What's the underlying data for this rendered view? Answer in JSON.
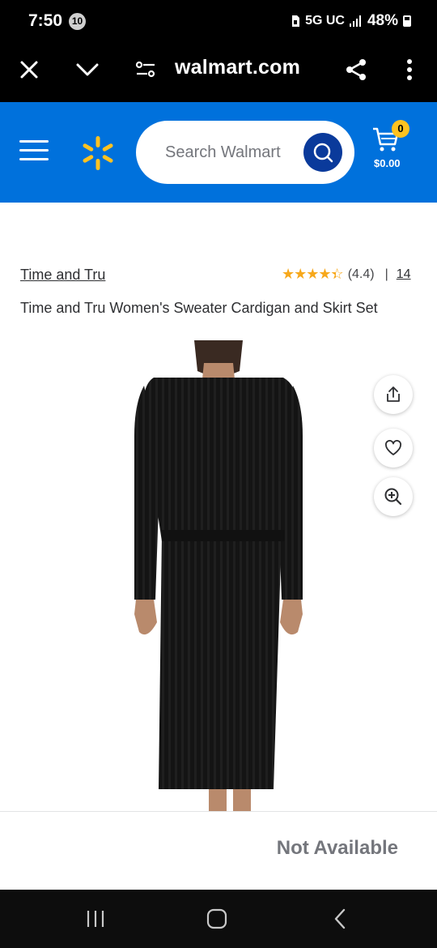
{
  "status_bar": {
    "time": "7:50",
    "notification_count": "10",
    "network": "5G UC",
    "battery": "48%"
  },
  "browser": {
    "url": "walmart.com",
    "icons": [
      "close-icon",
      "chevron-down-icon",
      "site-settings-icon",
      "share-icon",
      "more-vert-icon"
    ]
  },
  "header": {
    "search_placeholder": "Search Walmart",
    "cart_count": "0",
    "cart_total": "$0.00",
    "colors": {
      "brand_blue": "#0071dc",
      "spark_yellow": "#ffc220",
      "search_button": "#0a3a9b"
    }
  },
  "product": {
    "brand": "Time and Tru",
    "rating_value": "(4.4)",
    "rating_stars": 4.4,
    "rating_separator": "|",
    "review_count": "14",
    "title": "Time and Tru Women's Sweater Cardigan and Skirt Set",
    "image_icons": [
      "share-icon",
      "heart-icon",
      "zoom-in-icon"
    ]
  },
  "footer": {
    "availability": "Not Available"
  },
  "nav_bar": {
    "icons": [
      "recent-apps-icon",
      "home-icon",
      "back-icon"
    ]
  }
}
